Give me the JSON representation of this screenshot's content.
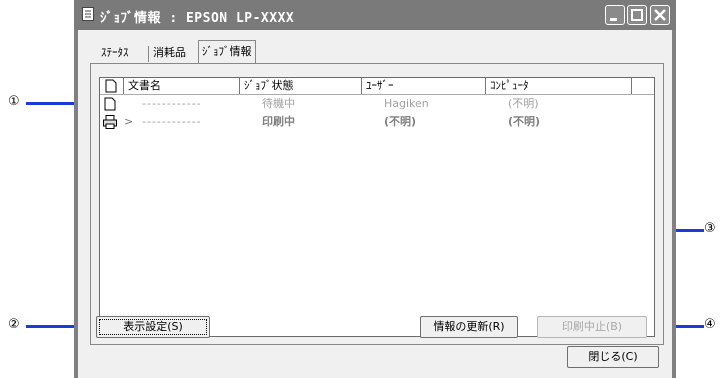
{
  "window": {
    "title": "ｼﾞｮﾌﾞ情報 : EPSON LP-XXXX",
    "controls": [
      "minimize-icon",
      "maximize-icon",
      "close-icon"
    ]
  },
  "tabs": [
    {
      "label": "ｽﾃｰﾀｽ",
      "selected": false
    },
    {
      "label": "消耗品",
      "selected": false
    },
    {
      "label": "ｼﾞｮﾌﾞ情報",
      "selected": true
    }
  ],
  "list": {
    "columns": [
      "文書名",
      "ｼﾞｮﾌﾞ状態",
      "ﾕｰｻﾞｰ",
      "ｺﾝﾋﾟｭｰﾀ"
    ],
    "rows": [
      {
        "icon": "document-icon",
        "name": "------------",
        "status": "待機中",
        "user": "Hagiken",
        "computer": "(不明)"
      },
      {
        "icon": "printer-icon",
        "marker": ">",
        "name": "------------",
        "status": "印刷中",
        "user": "(不明)",
        "computer": "(不明)"
      }
    ]
  },
  "buttons": {
    "display_settings": "表示設定(S)",
    "refresh": "情報の更新(R)",
    "cancel_print": "印刷中止(B)",
    "close": "閉じる(C)"
  },
  "callouts": [
    "①",
    "②",
    "③",
    "④"
  ],
  "colors": {
    "callout_line": "#1a3bd6",
    "titlebar": "#7a7a7a"
  }
}
